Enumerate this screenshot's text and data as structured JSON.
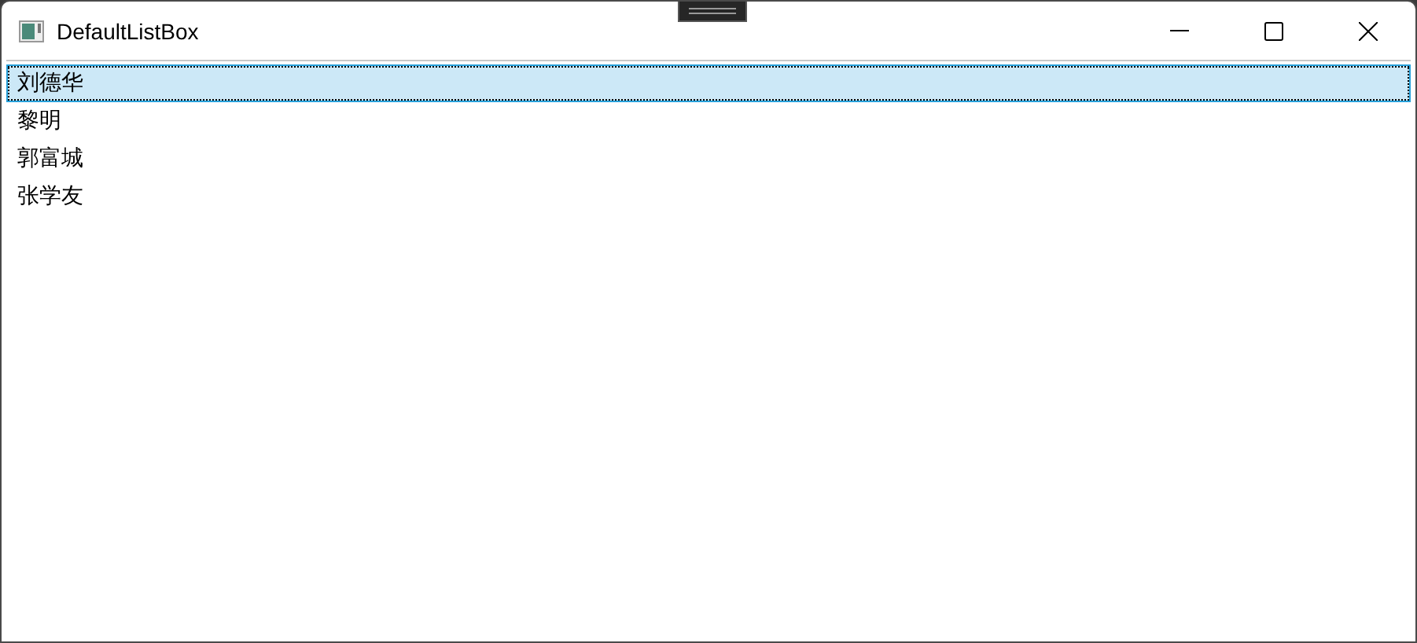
{
  "window": {
    "title": "DefaultListBox"
  },
  "list": {
    "items": [
      {
        "label": "刘德华",
        "selected": true
      },
      {
        "label": "黎明",
        "selected": false
      },
      {
        "label": "郭富城",
        "selected": false
      },
      {
        "label": "张学友",
        "selected": false
      }
    ]
  }
}
